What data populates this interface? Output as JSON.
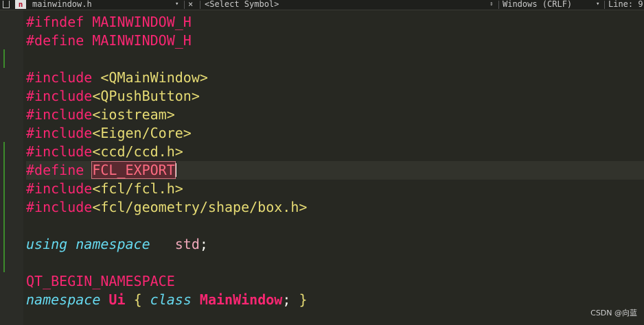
{
  "toolbar": {
    "file_name": "mainwindow.h",
    "close_glyph": "×",
    "symbol_select": "<Select Symbol>",
    "line_ending": "Windows (CRLF)",
    "line_label": "Line: 9",
    "badge": "n"
  },
  "code": {
    "l1": {
      "kw": "#ifndef",
      "name": "MAINWINDOW_H"
    },
    "l2": {
      "kw": "#define",
      "name": "MAINWINDOW_H"
    },
    "l4": {
      "kw": "#include",
      "path": "<QMainWindow>"
    },
    "l5": {
      "kw": "#include",
      "path": "<QPushButton>"
    },
    "l6": {
      "kw": "#include",
      "path": "<iostream>"
    },
    "l7": {
      "kw": "#include",
      "path": "<Eigen/Core>"
    },
    "l8": {
      "kw": "#include",
      "path": "<ccd/ccd.h>"
    },
    "l9": {
      "kw": "#define",
      "name": "FCL_EXPORT"
    },
    "l10": {
      "kw": "#include",
      "path": "<fcl/fcl.h>"
    },
    "l11": {
      "kw": "#include",
      "path": "<fcl/geometry/shape/box.h>"
    },
    "l13": {
      "using": "using",
      "namespace": "namespace",
      "std": "std",
      "semi": ";"
    },
    "l15": {
      "macro": "QT_BEGIN_NAMESPACE"
    },
    "l16": {
      "namespace": "namespace",
      "ui": "Ui",
      "open": "{",
      "class": "class",
      "name": "MainWindow",
      "semi": ";",
      "close": "}"
    }
  },
  "watermark": "CSDN @向蓝",
  "colors": {
    "background": "#272822",
    "preprocessor": "#f92672",
    "include_path": "#e6db74",
    "keyword_italic": "#66d9ef",
    "change_marker": "#3d8c2c"
  }
}
